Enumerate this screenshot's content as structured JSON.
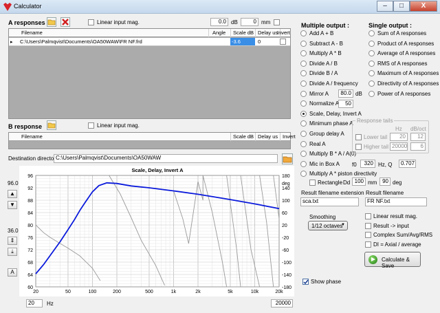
{
  "window": {
    "title": "Calculator",
    "minimize": "–",
    "maximize": "□",
    "close": "X"
  },
  "a_responses": {
    "label": "A responses",
    "linear_input_label": "Linear input mag.",
    "offset_db": "0.0",
    "db_unit": "dB",
    "offset_mm": "0",
    "mm_unit": "mm",
    "columns": [
      "Filename",
      "Angle",
      "Scale dB",
      "Delay us",
      "Invert"
    ],
    "rows": [
      {
        "filename": "C:\\Users\\Palmqvist\\Documents\\OA50WAW\\FR NF.frd",
        "angle": "",
        "scale_db": "-3.6",
        "delay_us": "0"
      }
    ]
  },
  "b_response": {
    "label": "B response",
    "linear_input_label": "Linear input mag.",
    "columns": [
      "Filename",
      "Scale dB",
      "Delay us",
      "Invert"
    ]
  },
  "destination": {
    "label": "Destination directory",
    "value": "C:\\Users\\Palmqvist\\Documents\\OA50WAW"
  },
  "multiple_output": {
    "header": "Multiple output :",
    "items": [
      "Add A + B",
      "Subtract A - B",
      "Multiply A * B",
      "Divide A / B",
      "Divide B / A",
      "Divide A / frequency",
      "Mirror A",
      "Normalize A",
      "Scale, Delay, Invert A",
      "Minimum phase A",
      "Group delay A",
      "Real A",
      "Multiply B * A / A(0)",
      "Mic in Box A",
      "Multiply A * piston directivity"
    ],
    "selected": "Scale, Delay, Invert A",
    "mirror_value": "80.0",
    "mirror_unit": "dB",
    "normalize_value": "50",
    "mic_f0_label": "f0",
    "mic_f0": "320",
    "mic_hz_q_label": "Hz, Q",
    "mic_q": "0.707",
    "rectangle_label": "Rectangle",
    "dd_label": "Dd",
    "dd_value": "100",
    "dd_unit": "mm",
    "deg_value": "90",
    "deg_unit": "deg"
  },
  "single_output": {
    "header": "Single output :",
    "items": [
      "Sum of A responses",
      "Product of A responses",
      "Average of A responses",
      "RMS of A responses",
      "Maximum of A responses",
      "Directivity of A responses",
      "Power of A responses"
    ]
  },
  "response_tails": {
    "title": "Response tails",
    "hz_label": "Hz",
    "dboct_label": "dB/oct",
    "lower_tail_label": "Lower tail",
    "lower_hz": "20",
    "lower_dboct": "12",
    "higher_tail_label": "Higher tail",
    "higher_hz": "20000",
    "higher_dboct": "6"
  },
  "result": {
    "ext_label": "Result filename extension",
    "ext_value": "sca.txt",
    "filename_label": "Result filename",
    "filename_value": "FR NF.txt"
  },
  "smoothing": {
    "label": "Smoothing",
    "value": "1/12 octaves"
  },
  "options": [
    "Linear result mag.",
    "Result -> input",
    "Complex Sum/Avg/RMS",
    "DI = Axial / average"
  ],
  "calculate_label": "Calculate & Save",
  "show_phase_label": "Show phase",
  "plot": {
    "y_top": "96.0",
    "y_bottom": "36.0",
    "x_min": "20",
    "x_max": "20000",
    "hz_label": "Hz"
  },
  "chart_data": {
    "type": "line",
    "title": "Scale, Delay, Invert A",
    "xlabel": "",
    "ylabel": "",
    "y2label": "deg",
    "x_scale": "log",
    "xlim": [
      20,
      20000
    ],
    "ylim": [
      60,
      96
    ],
    "y2lim": [
      -180,
      180
    ],
    "x_ticks": [
      "20",
      "50",
      "100",
      "200",
      "500",
      "1k",
      "2k",
      "5k",
      "10k",
      "20k"
    ],
    "y_ticks": [
      "96",
      "92",
      "88",
      "84",
      "80",
      "76",
      "72",
      "68",
      "64",
      "60"
    ],
    "y2_ticks": [
      "180",
      "140",
      "100",
      "60",
      "20",
      "-20",
      "-60",
      "-100",
      "-140",
      "-180"
    ],
    "series": [
      {
        "role": "magnitude",
        "color": "#0a1adb",
        "x": [
          20,
          25,
          30,
          40,
          50,
          60,
          70,
          80,
          100,
          120,
          150,
          200,
          300,
          500,
          1000,
          2000,
          5000,
          10000,
          20000
        ],
        "y": [
          64.2,
          67.2,
          70.1,
          74.6,
          78.5,
          81.7,
          84.7,
          87.0,
          90.7,
          92.7,
          93.6,
          93.4,
          92.6,
          92.0,
          91.0,
          89.9,
          88.2,
          86.8,
          85.3
        ]
      },
      {
        "role": "phase",
        "color": "#9a9a9a",
        "x": [
          20,
          25,
          30,
          40,
          50,
          70,
          100,
          125,
          160,
          220,
          304,
          400,
          600,
          777,
          1000,
          1300,
          1533,
          2000,
          2300,
          2302,
          3000,
          4000,
          4500,
          4502,
          6000,
          6700,
          6702,
          9000,
          11500,
          11502,
          14000,
          17000,
          17002,
          20000
        ],
        "y": [
          20,
          -5,
          -20,
          -40,
          -55,
          -80,
          -120,
          -160,
          180,
          120,
          40,
          -30,
          -110,
          -175,
          130,
          40,
          -40,
          160,
          100,
          180,
          60,
          -100,
          -180,
          180,
          -60,
          -180,
          180,
          -60,
          -180,
          180,
          30,
          -180,
          180,
          40
        ]
      }
    ]
  }
}
